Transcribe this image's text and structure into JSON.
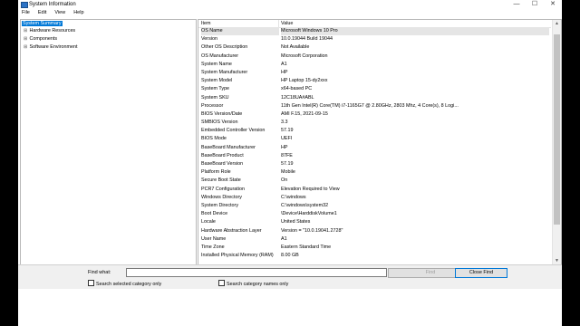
{
  "window": {
    "title": "System Information",
    "controls": {
      "minimize": "—",
      "maximize": "☐",
      "close": "✕"
    }
  },
  "menu": [
    "File",
    "Edit",
    "View",
    "Help"
  ],
  "tree": {
    "items": [
      {
        "label": "System Summary",
        "expander": "",
        "selected": true
      },
      {
        "label": "Hardware Resources",
        "expander": "⊞",
        "selected": false
      },
      {
        "label": "Components",
        "expander": "⊞",
        "selected": false
      },
      {
        "label": "Software Environment",
        "expander": "⊞",
        "selected": false
      }
    ]
  },
  "list": {
    "columns": [
      "Item",
      "Value"
    ],
    "rows": [
      {
        "item": "OS Name",
        "value": "Microsoft Windows 10 Pro"
      },
      {
        "item": "Version",
        "value": "10.0.19044 Build 19044"
      },
      {
        "item": "Other OS Description",
        "value": "Not Available"
      },
      {
        "item": "OS Manufacturer",
        "value": "Microsoft Corporation"
      },
      {
        "item": "System Name",
        "value": "A1"
      },
      {
        "item": "System Manufacturer",
        "value": "HP"
      },
      {
        "item": "System Model",
        "value": "HP Laptop 15-dy2xxx"
      },
      {
        "item": "System Type",
        "value": "x64-based PC"
      },
      {
        "item": "System SKU",
        "value": "12C18UA#ABL"
      },
      {
        "item": "Processor",
        "value": "11th Gen Intel(R) Core(TM) i7-1165G7 @ 2.80GHz, 2803 Mhz, 4 Core(s), 8 Logi..."
      },
      {
        "item": "BIOS Version/Date",
        "value": "AMI F.15, 2021-09-15"
      },
      {
        "item": "SMBIOS Version",
        "value": "3.3"
      },
      {
        "item": "Embedded Controller Version",
        "value": "57.19"
      },
      {
        "item": "BIOS Mode",
        "value": "UEFI"
      },
      {
        "item": "BaseBoard Manufacturer",
        "value": "HP"
      },
      {
        "item": "BaseBoard Product",
        "value": "87FE"
      },
      {
        "item": "BaseBoard Version",
        "value": "57.19"
      },
      {
        "item": "Platform Role",
        "value": "Mobile"
      },
      {
        "item": "Secure Boot State",
        "value": "On"
      },
      {
        "item": "PCR7 Configuration",
        "value": "Elevation Required to View"
      },
      {
        "item": "Windows Directory",
        "value": "C:\\windows"
      },
      {
        "item": "System Directory",
        "value": "C:\\windows\\system32"
      },
      {
        "item": "Boot Device",
        "value": "\\Device\\HarddiskVolume1"
      },
      {
        "item": "Locale",
        "value": "United States"
      },
      {
        "item": "Hardware Abstraction Layer",
        "value": "Version = \"10.0.19041.2728\""
      },
      {
        "item": "User Name",
        "value": "A1"
      },
      {
        "item": "Time Zone",
        "value": "Eastern Standard Time"
      },
      {
        "item": "Installed Physical Memory (RAM)",
        "value": "8.00 GB"
      }
    ]
  },
  "find": {
    "label": "Find what:",
    "value": "",
    "find_button": "Find",
    "close_button": "Close Find",
    "search_selected_label": "Search selected category only",
    "search_names_label": "Search category names only"
  }
}
